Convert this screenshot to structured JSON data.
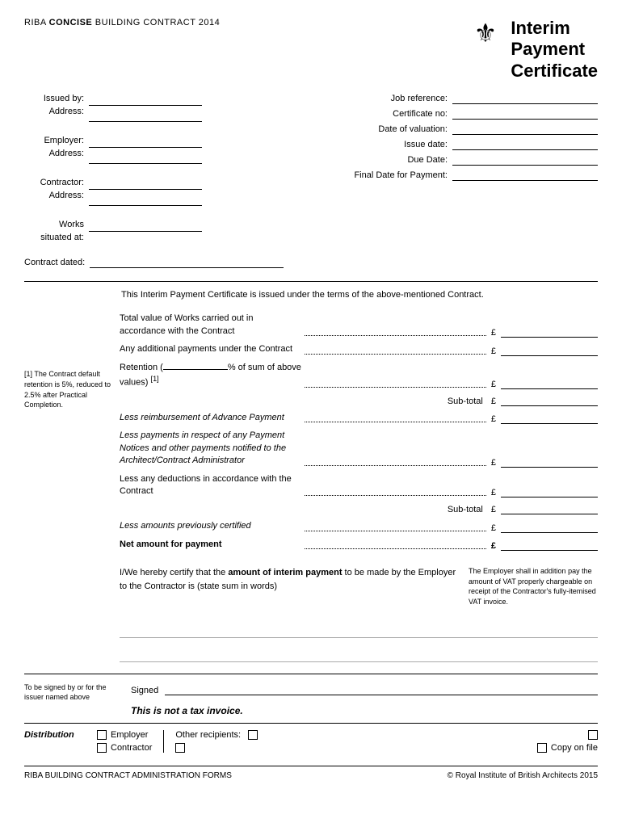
{
  "header": {
    "org_name": "RIBA ",
    "org_bold": "CONCISE",
    "org_suffix": " BUILDING CONTRACT 2014",
    "title_line1": "Interim",
    "title_line2": "Payment",
    "title_line3": "Certificate"
  },
  "left_fields": {
    "issued_by_label": "Issued by:",
    "address_label": "Address:",
    "employer_label": "Employer:",
    "employer_address_label": "Address:",
    "contractor_label": "Contractor:",
    "contractor_address_label": "Address:",
    "works_label": "Works",
    "situated_at_label": "situated at:"
  },
  "right_fields": {
    "job_reference_label": "Job reference:",
    "certificate_no_label": "Certificate no:",
    "date_of_valuation_label": "Date of valuation:",
    "issue_date_label": "Issue date:",
    "due_date_label": "Due Date:",
    "final_date_label": "Final Date for Payment:"
  },
  "contract_dated": {
    "label": "Contract dated:"
  },
  "intro": {
    "text": "This Interim Payment Certificate is issued under the terms of the above-mentioned Contract."
  },
  "footnote": {
    "number": "[1]",
    "text": "The Contract default retention is 5%, reduced to 2.5% after Practical Completion."
  },
  "calc_rows": [
    {
      "id": "total-value",
      "desc": "Total value of Works carried out in accordance with the Contract",
      "italic": false,
      "bold": false,
      "has_dots": true,
      "pound": "£"
    },
    {
      "id": "additional-payments",
      "desc": "Any additional payments under the Contract",
      "italic": false,
      "bold": false,
      "has_dots": true,
      "pound": "£"
    },
    {
      "id": "retention",
      "desc": "Retention (",
      "desc_suffix": "% of sum of above values)",
      "footnote_ref": "[1]",
      "italic": false,
      "bold": false,
      "has_dots": true,
      "pound": "£",
      "is_retention": true
    }
  ],
  "subtotal1": {
    "label": "Sub-total",
    "pound": "£"
  },
  "calc_rows2": [
    {
      "id": "advance-payment",
      "desc": "Less reimbursement of Advance Payment",
      "italic": true,
      "bold": false,
      "has_dots": true,
      "pound": "£"
    },
    {
      "id": "payment-notices",
      "desc": "Less payments in respect of any Payment Notices and other payments notified to the Architect/Contract Administrator",
      "italic": true,
      "bold": false,
      "has_dots": true,
      "pound": "£"
    },
    {
      "id": "deductions",
      "desc": "Less any deductions in accordance with the Contract",
      "italic": false,
      "bold": false,
      "has_dots": true,
      "pound": "£"
    }
  ],
  "subtotal2": {
    "label": "Sub-total",
    "pound": "£"
  },
  "calc_rows3": [
    {
      "id": "previously-certified",
      "desc": "Less amounts previously certified",
      "italic": true,
      "bold": false,
      "has_dots": true,
      "pound": "£"
    },
    {
      "id": "net-amount",
      "desc": "Net amount for payment",
      "italic": false,
      "bold": true,
      "has_dots": true,
      "pound": "£"
    }
  ],
  "certification": {
    "text_start": "I/We hereby certify that the ",
    "text_bold": "amount of interim payment",
    "text_end": " to be made by the Employer to the Contractor is (state sum in words)",
    "vat_note": "The Employer shall in addition pay the amount of VAT properly chargeable on receipt of the Contractor's fully-itemised VAT invoice."
  },
  "sign_section": {
    "label": "To be signed by or for the issuer named above",
    "signed_text": "Signed",
    "not_tax_text": "This is not a tax invoice."
  },
  "distribution": {
    "label": "Distribution",
    "items_left": [
      {
        "id": "employer-check",
        "label": "Employer"
      },
      {
        "id": "contractor-check",
        "label": "Contractor"
      }
    ],
    "other_recipients_label": "Other recipients:",
    "other_boxes": [
      {
        "id": "other-box-1"
      },
      {
        "id": "other-box-2"
      }
    ],
    "extra_boxes": [
      {
        "id": "extra-box-1"
      },
      {
        "id": "copy-on-file",
        "label": "Copy on file"
      }
    ]
  },
  "footer": {
    "left": "RIBA BUILDING CONTRACT ADMINISTRATION FORMS",
    "right": "© Royal Institute of British Architects 2015"
  }
}
